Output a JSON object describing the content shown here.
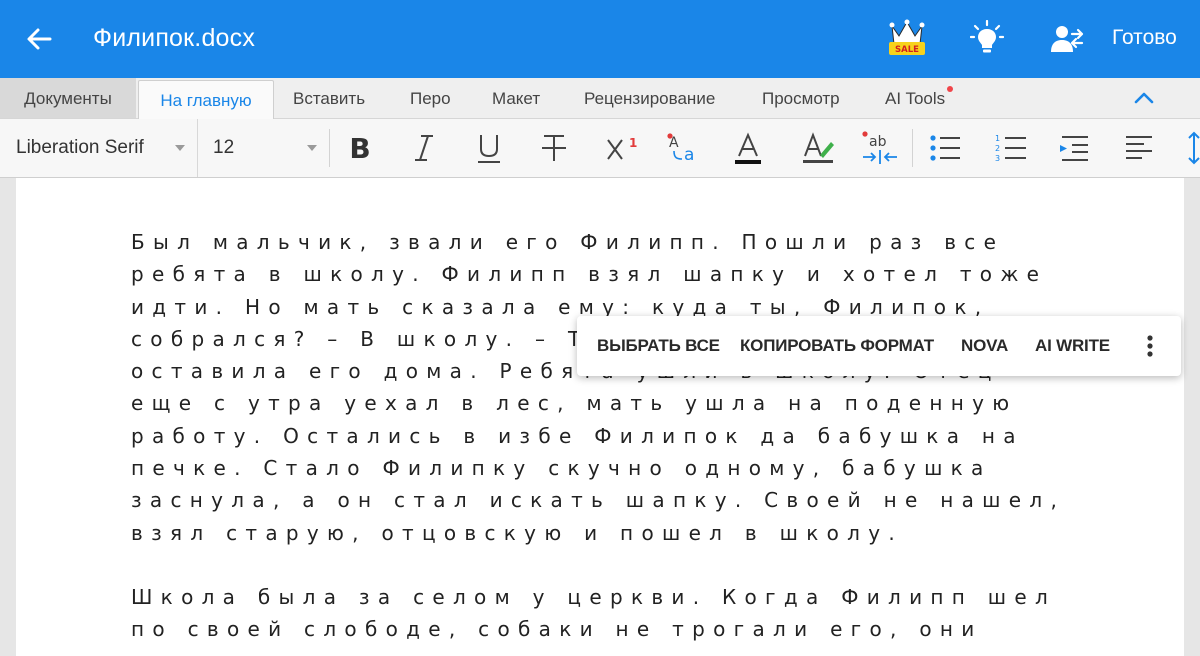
{
  "app": {
    "title": "Филипок.docx",
    "done_label": "Готово",
    "sale_badge": "SALE",
    "accent_color": "#1a86e8"
  },
  "tabs": [
    {
      "label": "Документы"
    },
    {
      "label": "На главную",
      "active": true
    },
    {
      "label": "Вставить"
    },
    {
      "label": "Перо"
    },
    {
      "label": "Макет"
    },
    {
      "label": "Рецензирование"
    },
    {
      "label": "Просмотр"
    },
    {
      "label": "AI Tools",
      "badge": true
    }
  ],
  "toolbar": {
    "font": "Liberation Serif",
    "size": "12",
    "superscript_mark": "1",
    "icons": [
      "bold-icon",
      "italic-icon",
      "underline-icon",
      "strikethrough-icon",
      "superscript-icon",
      "font-case-icon",
      "font-color-icon",
      "highlight-icon",
      "character-spacing-icon",
      "bullet-list-icon",
      "numbered-list-icon",
      "indent-icon",
      "align-left-icon",
      "line-spacing-icon"
    ]
  },
  "document": {
    "paragraph1": [
      "Был мальчик, звали его Филипп. Пошли раз все",
      "ребята в школу. Филипп взял шапку и хотел тоже",
      "идти. Но мать сказала ему: куда ты, Филипок,",
      "собрался? – В школу. – Ты",
      "оставила его дома. Ребята ушли в школу. Отец",
      "еще с утра уехал в лес, мать ушла на поденную",
      "работу. Остались в избе Филипок да бабушка на",
      "печке. Стало Филипку скучно одному, бабушка",
      "заснула, а он стал искать шапку. Своей не нашел,",
      "взял старую, отцовскую и пошел в школу."
    ],
    "paragraph2": [
      "Школа была за селом у церкви. Когда Филипп шел",
      "по своей слободе, собаки не трогали его, они"
    ]
  },
  "context_menu": {
    "select_all": "ВЫБРАТЬ ВСЕ",
    "copy_format": "КОПИРОВАТЬ ФОРМАТ",
    "nova": "NOVA",
    "ai_write": "AI WRITE"
  }
}
